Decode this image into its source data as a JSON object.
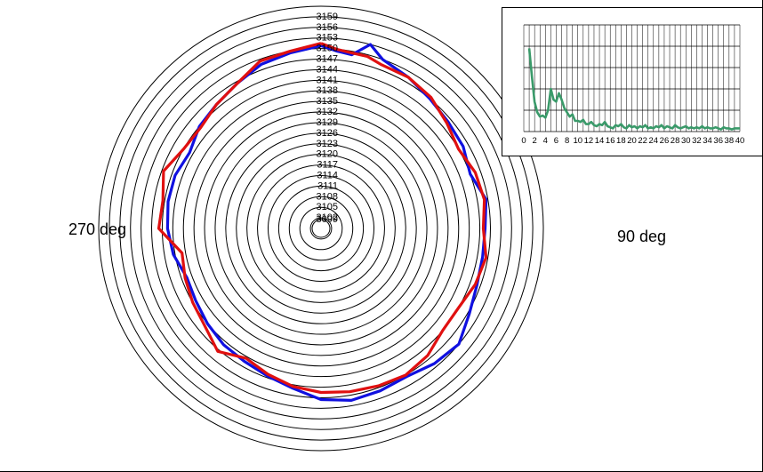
{
  "chart_data": [
    {
      "type": "polar",
      "radial_ticks": [
        "3159",
        "3156",
        "3153",
        "3150",
        "3147",
        "3144",
        "3141",
        "3138",
        "3135",
        "3132",
        "3129",
        "3126",
        "3123",
        "3120",
        "3117",
        "3114",
        "3111",
        "3108",
        "3105",
        "3102",
        "3099"
      ],
      "radial_range": [
        3099,
        3162
      ],
      "angle_labels": [
        "270 deg",
        "90 deg"
      ],
      "series": [
        {
          "color": "#1010e0",
          "angles_deg": [
            0,
            10,
            20,
            30,
            40,
            50,
            60,
            70,
            80,
            90,
            100,
            110,
            120,
            130,
            140,
            150,
            160,
            170,
            180,
            190,
            200,
            210,
            220,
            230,
            240,
            250,
            260,
            270,
            280,
            290,
            300,
            310,
            320,
            330,
            340,
            345,
            350,
            355
          ],
          "values": [
            3150.8,
            3149.5,
            3148.5,
            3146.5,
            3145,
            3144,
            3142,
            3143,
            3143,
            3142.5,
            3141.5,
            3139.5,
            3140,
            3141,
            3142,
            3142.5,
            3143.5,
            3145,
            3147.5,
            3148.5,
            3148,
            3147.5,
            3149,
            3150,
            3147.5,
            3146,
            3145.5,
            3145.5,
            3146.5,
            3144,
            3145.5,
            3146,
            3147,
            3148.5,
            3150,
            3153,
            3149,
            3149.5
          ]
        },
        {
          "color": "#e01010",
          "angles_deg": [
            0,
            10,
            20,
            30,
            40,
            50,
            60,
            70,
            80,
            90,
            100,
            110,
            120,
            130,
            140,
            150,
            160,
            170,
            180,
            190,
            200,
            210,
            220,
            230,
            240,
            250,
            260,
            270,
            280,
            290,
            300,
            310,
            320,
            330,
            340,
            345,
            350,
            355
          ],
          "values": [
            3151.5,
            3150,
            3149.5,
            3146.5,
            3145,
            3143.5,
            3144,
            3146.5,
            3144.5,
            3145,
            3139,
            3140,
            3141,
            3142,
            3144.5,
            3141.5,
            3143,
            3144.5,
            3145.5,
            3146,
            3146.5,
            3147,
            3146,
            3144,
            3144,
            3145.5,
            3146.5,
            3145,
            3146,
            3145.5,
            3144,
            3145.5,
            3147.5,
            3148.5,
            3148.5,
            3149.5,
            3149.5,
            3150
          ]
        }
      ]
    },
    {
      "type": "line",
      "x_ticks": [
        "0",
        "2",
        "4",
        "6",
        "8",
        "10",
        "12",
        "14",
        "16",
        "18",
        "20",
        "22",
        "24",
        "26",
        "28",
        "30",
        "32",
        "34",
        "36",
        "38",
        "40"
      ],
      "xlim": [
        0,
        40
      ],
      "ylim": [
        0,
        100
      ],
      "grid": true,
      "series": [
        {
          "color": "#3a9a6a",
          "x": [
            1,
            1.5,
            2,
            2.5,
            3,
            3.5,
            4,
            4.5,
            5,
            5.5,
            6,
            6.5,
            7,
            7.5,
            8,
            8.5,
            9,
            9.5,
            10,
            10.5,
            11,
            11.5,
            12,
            12.5,
            13,
            13.5,
            14,
            14.5,
            15,
            15.5,
            16,
            16.5,
            17,
            17.5,
            18,
            18.5,
            19,
            19.5,
            20,
            20.5,
            21,
            21.5,
            22,
            22.5,
            23,
            23.5,
            24,
            24.5,
            25,
            25.5,
            26,
            26.5,
            27,
            27.5,
            28,
            28.5,
            29,
            29.5,
            30,
            30.5,
            31,
            31.5,
            32,
            32.5,
            33,
            33.5,
            34,
            34.5,
            35,
            35.5,
            36,
            36.5,
            37,
            37.5,
            38,
            38.5,
            39,
            39.5,
            40
          ],
          "values": [
            78,
            52,
            28,
            18,
            14,
            15,
            13,
            20,
            40,
            30,
            28,
            36,
            30,
            22,
            18,
            14,
            16,
            10,
            10,
            9,
            11,
            7,
            7,
            9,
            6,
            5,
            7,
            6,
            9,
            5,
            4,
            3,
            6,
            5,
            7,
            4,
            3,
            6,
            4,
            5,
            3,
            5,
            4,
            6,
            3,
            4,
            3,
            5,
            4,
            6,
            3,
            5,
            4,
            3,
            6,
            4,
            3,
            4,
            5,
            3,
            4,
            3,
            4,
            3,
            5,
            3,
            4,
            3,
            3,
            4,
            3,
            2,
            4,
            3,
            3,
            2,
            3,
            3,
            3
          ]
        }
      ]
    }
  ]
}
